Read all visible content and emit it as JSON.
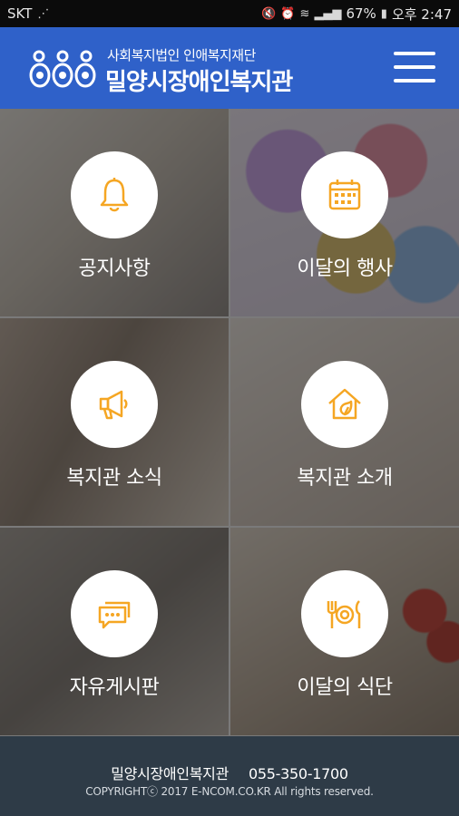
{
  "status_bar": {
    "carrier": "SKT",
    "battery_percent": "67%",
    "time": "오후 2:47"
  },
  "header": {
    "subtitle": "사회복지법인 인애복지재단",
    "title": "밀양시장애인복지관",
    "accent_color": "#2f61c9"
  },
  "tiles": [
    {
      "label": "공지사항",
      "icon": "bell-icon"
    },
    {
      "label": "이달의 행사",
      "icon": "calendar-icon"
    },
    {
      "label": "복지관 소식",
      "icon": "megaphone-icon"
    },
    {
      "label": "복지관 소개",
      "icon": "house-leaf-icon"
    },
    {
      "label": "자유게시판",
      "icon": "chat-bubbles-icon"
    },
    {
      "label": "이달의 식단",
      "icon": "dining-plate-icon"
    }
  ],
  "icon_color": "#f5a623",
  "footer": {
    "org_name": "밀양시장애인복지관",
    "phone": "055-350-1700",
    "copyright": "COPYRIGHTⓒ 2017 E-NCOM.CO.KR All rights reserved."
  }
}
